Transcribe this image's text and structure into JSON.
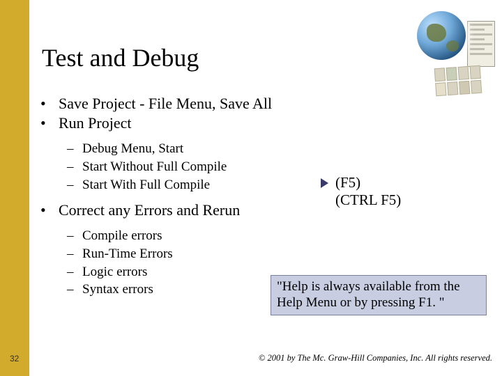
{
  "title": "Test and Debug",
  "bullets": {
    "l1": [
      "Save Project - File Menu, Save All",
      "Run Project",
      "Correct any Errors and Rerun"
    ],
    "run_subs": [
      "Debug Menu, Start",
      "Start Without Full Compile",
      "Start With Full Compile"
    ],
    "err_subs": [
      "Compile errors",
      "Run-Time Errors",
      "Logic errors",
      "Syntax errors"
    ]
  },
  "shortcuts": {
    "line1": "(F5)",
    "line2": "(CTRL F5)"
  },
  "callout": "\"Help is always available from the Help Menu or by pressing F1. \"",
  "page_number": "32",
  "copyright": "© 2001 by The Mc. Graw-Hill Companies, Inc. All rights reserved."
}
